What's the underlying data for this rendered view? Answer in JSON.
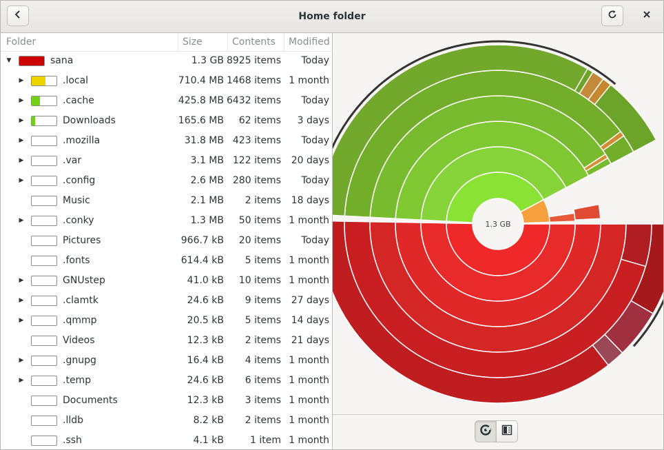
{
  "window": {
    "title": "Home folder"
  },
  "headerbar": {
    "back_icon": "go-back-icon",
    "refresh_icon": "refresh-icon",
    "close_icon": "close-icon"
  },
  "table": {
    "columns": [
      "Folder",
      "Size",
      "Contents",
      "Modified"
    ],
    "rows": [
      {
        "name": "sana",
        "size": "1.3 GB",
        "contents": "8925 items",
        "modified": "Today",
        "expander": "open",
        "level": 0,
        "usage": 1.0,
        "color": "#cc0000"
      },
      {
        "name": ".local",
        "size": "710.4 MB",
        "contents": "1468 items",
        "modified": "1 month",
        "expander": "closed",
        "level": 1,
        "usage": 0.55,
        "color": "#edd400"
      },
      {
        "name": ".cache",
        "size": "425.8 MB",
        "contents": "6432 items",
        "modified": "Today",
        "expander": "closed",
        "level": 1,
        "usage": 0.33,
        "color": "#73d216"
      },
      {
        "name": "Downloads",
        "size": "165.6 MB",
        "contents": "62 items",
        "modified": "3 days",
        "expander": "closed",
        "level": 1,
        "usage": 0.13,
        "color": "#73d216"
      },
      {
        "name": ".mozilla",
        "size": "31.8 MB",
        "contents": "423 items",
        "modified": "Today",
        "expander": "closed",
        "level": 1,
        "usage": 0.0,
        "color": "#73d216"
      },
      {
        "name": ".var",
        "size": "3.1 MB",
        "contents": "122 items",
        "modified": "20 days",
        "expander": "closed",
        "level": 1,
        "usage": 0.0,
        "color": "#73d216"
      },
      {
        "name": ".config",
        "size": "2.6 MB",
        "contents": "280 items",
        "modified": "Today",
        "expander": "closed",
        "level": 1,
        "usage": 0.0,
        "color": "#73d216"
      },
      {
        "name": "Music",
        "size": "2.1 MB",
        "contents": "2 items",
        "modified": "18 days",
        "expander": "none",
        "level": 1,
        "usage": 0.0,
        "color": "#73d216"
      },
      {
        "name": ".conky",
        "size": "1.3 MB",
        "contents": "50 items",
        "modified": "1 month",
        "expander": "closed",
        "level": 1,
        "usage": 0.0,
        "color": "#73d216"
      },
      {
        "name": "Pictures",
        "size": "966.7 kB",
        "contents": "20 items",
        "modified": "Today",
        "expander": "none",
        "level": 1,
        "usage": 0.0,
        "color": "#73d216"
      },
      {
        "name": ".fonts",
        "size": "614.4 kB",
        "contents": "5 items",
        "modified": "1 month",
        "expander": "none",
        "level": 1,
        "usage": 0.0,
        "color": "#73d216"
      },
      {
        "name": "GNUstep",
        "size": "41.0 kB",
        "contents": "10 items",
        "modified": "1 month",
        "expander": "closed",
        "level": 1,
        "usage": 0.0,
        "color": "#73d216"
      },
      {
        "name": ".clamtk",
        "size": "24.6 kB",
        "contents": "9 items",
        "modified": "27 days",
        "expander": "closed",
        "level": 1,
        "usage": 0.0,
        "color": "#73d216"
      },
      {
        "name": ".qmmp",
        "size": "20.5 kB",
        "contents": "5 items",
        "modified": "14 days",
        "expander": "closed",
        "level": 1,
        "usage": 0.0,
        "color": "#73d216"
      },
      {
        "name": "Videos",
        "size": "12.3 kB",
        "contents": "2 items",
        "modified": "21 days",
        "expander": "none",
        "level": 1,
        "usage": 0.0,
        "color": "#73d216"
      },
      {
        "name": ".gnupg",
        "size": "16.4 kB",
        "contents": "4 items",
        "modified": "1 month",
        "expander": "closed",
        "level": 1,
        "usage": 0.0,
        "color": "#73d216"
      },
      {
        "name": ".temp",
        "size": "24.6 kB",
        "contents": "6 items",
        "modified": "1 month",
        "expander": "closed",
        "level": 1,
        "usage": 0.0,
        "color": "#73d216"
      },
      {
        "name": "Documents",
        "size": "12.3 kB",
        "contents": "3 items",
        "modified": "1 month",
        "expander": "none",
        "level": 1,
        "usage": 0.0,
        "color": "#73d216"
      },
      {
        "name": ".lldb",
        "size": "8.2 kB",
        "contents": "2 items",
        "modified": "1 month",
        "expander": "none",
        "level": 1,
        "usage": 0.0,
        "color": "#73d216"
      },
      {
        "name": ".ssh",
        "size": "4.1 kB",
        "contents": "1 item",
        "modified": "1 month",
        "expander": "none",
        "level": 1,
        "usage": 0.0,
        "color": "#73d216"
      }
    ]
  },
  "chart": {
    "center_label": "1.3 GB",
    "colors": {
      "red": "#e52b2b",
      "green": "#8bc53f",
      "orange": "#f5a03c",
      "maroon": "#a8404f",
      "highlight": "#333333"
    }
  },
  "view_switcher": {
    "rings_icon": "rings-chart-icon",
    "treemap_icon": "treemap-chart-icon",
    "active": "rings"
  }
}
